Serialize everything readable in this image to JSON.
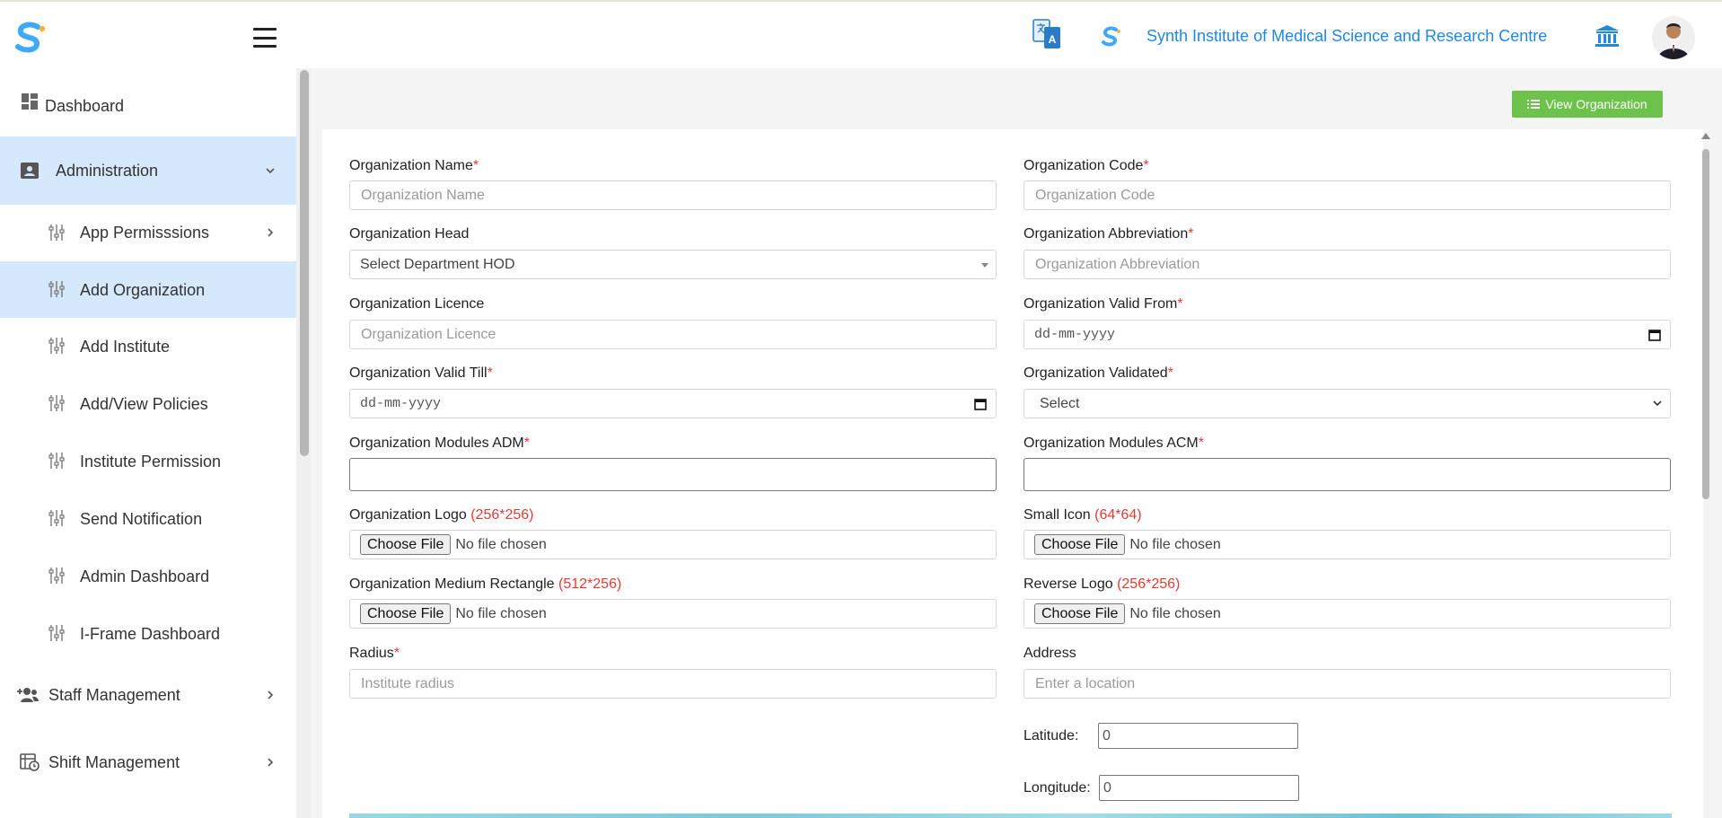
{
  "header": {
    "institute_name": "Synth Institute of Medical Science and Research Centre",
    "icons": [
      "app-logo",
      "hamburger-menu-icon",
      "translate-icon",
      "institute-logo",
      "institution-bank-icon",
      "user-avatar"
    ]
  },
  "sidebar": {
    "items": [
      {
        "label": "Dashboard",
        "icon": "dashboard-icon"
      },
      {
        "label": "Administration",
        "icon": "id-card-icon",
        "expanded": true
      },
      {
        "label": "App Permisssions",
        "icon": "sliders-icon"
      },
      {
        "label": "Add Organization",
        "icon": "sliders-icon",
        "active": true
      },
      {
        "label": "Add Institute",
        "icon": "sliders-icon"
      },
      {
        "label": "Add/View Policies",
        "icon": "sliders-icon"
      },
      {
        "label": "Institute Permission",
        "icon": "sliders-icon"
      },
      {
        "label": "Send Notification",
        "icon": "sliders-icon"
      },
      {
        "label": "Admin Dashboard",
        "icon": "sliders-icon"
      },
      {
        "label": "I-Frame Dashboard",
        "icon": "sliders-icon"
      },
      {
        "label": "Staff Management",
        "icon": "user-plus-icon"
      },
      {
        "label": "Shift Management",
        "icon": "calendar-clock-icon"
      }
    ]
  },
  "toolbar": {
    "view_organization_label": "View Organization"
  },
  "form": {
    "org_name": {
      "label": "Organization Name",
      "req": "*",
      "placeholder": "Organization Name"
    },
    "org_code": {
      "label": "Organization Code",
      "req": "*",
      "placeholder": "Organization Code"
    },
    "org_head": {
      "label": "Organization Head",
      "value": "Select Department HOD"
    },
    "org_abbr": {
      "label": "Organization Abbreviation",
      "req": "*",
      "placeholder": "Organization Abbreviation"
    },
    "org_licence": {
      "label": "Organization Licence",
      "placeholder": "Organization Licence"
    },
    "org_valid_from": {
      "label": "Organization Valid From",
      "req": "*",
      "value": "dd-mm-yyyy"
    },
    "org_valid_till": {
      "label": "Organization Valid Till",
      "req": "*",
      "value": "dd-mm-yyyy"
    },
    "org_validated": {
      "label": "Organization Validated",
      "req": "*",
      "value": "Select"
    },
    "modules_adm": {
      "label": "Organization Modules ADM",
      "req": "*"
    },
    "modules_acm": {
      "label": "Organization Modules ACM",
      "req": "*"
    },
    "org_logo": {
      "label": "Organization Logo",
      "dim": "(256*256)",
      "button": "Choose File",
      "status": "No file chosen"
    },
    "small_icon": {
      "label": "Small Icon",
      "dim": "(64*64)",
      "button": "Choose File",
      "status": "No file chosen"
    },
    "medium_rect": {
      "label": "Organization Medium Rectangle",
      "dim": "(512*256)",
      "button": "Choose File",
      "status": "No file chosen"
    },
    "reverse_logo": {
      "label": "Reverse Logo",
      "dim": "(256*256)",
      "button": "Choose File",
      "status": "No file chosen"
    },
    "radius": {
      "label": "Radius",
      "req": "*",
      "placeholder": "Institute radius"
    },
    "address": {
      "label": "Address",
      "placeholder": "Enter a location"
    },
    "latitude": {
      "label": "Latitude:",
      "value": "0"
    },
    "longitude": {
      "label": "Longitude:",
      "value": "0"
    }
  },
  "colors": {
    "accent_blue": "#1e88e5",
    "active_bg": "#d6e8fb",
    "success_green": "#6cc24a",
    "required_red": "#e53935"
  }
}
